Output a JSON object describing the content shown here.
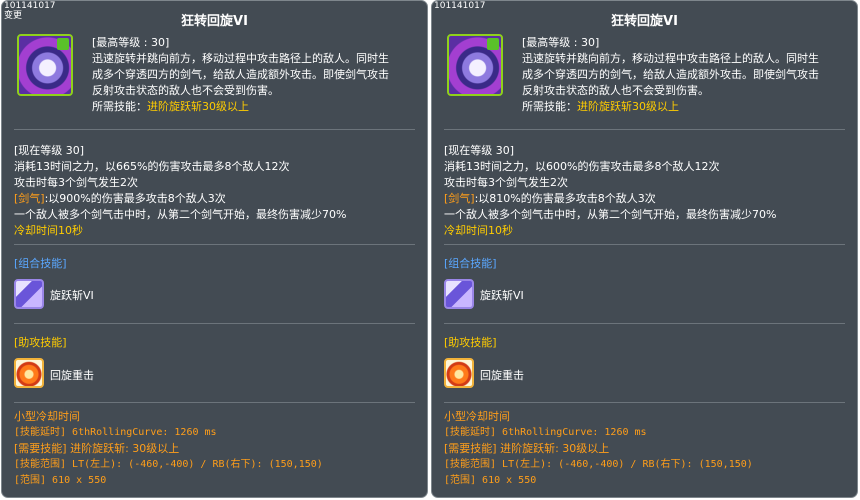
{
  "panels": [
    {
      "skill_id": "101141017",
      "top_tag": "变更",
      "title": "狂转回旋VI",
      "desc": {
        "max_level": "[最高等级 : 30]",
        "lines": [
          "迅速旋转并跳向前方，移动过程中攻击路径上的敌人。同时生",
          "成多个穿透四方的剑气，给敌人造成额外攻击。即使剑气攻击",
          "反射攻击状态的敌人也不会受到伤害。"
        ],
        "req_label": "所需技能：",
        "req_value": "进阶旋跃斩30级以上"
      },
      "current": {
        "header": "[现在等级 30]",
        "line1": "消耗13时间之力，以665%的伤害攻击最多8个敌人12次",
        "line2": "攻击时每3个剑气发生2次",
        "sword_label": "[剑气]",
        "sword_text": ":以900%的伤害最多攻击8个敌人3次",
        "line4": "一个敌人被多个剑气击中时，从第二个剑气开始，最终伤害减少70%",
        "cooldown": "冷却时间10秒"
      },
      "combo": {
        "header": "[组合技能]",
        "skill": "旋跃斩VI",
        "icon": "whirl-slash-icon"
      },
      "assist": {
        "header": "[助攻技能]",
        "skill": "回旋重击",
        "icon": "spin-strike-icon"
      },
      "footer": [
        "小型冷却时间",
        "[技能延时] 6thRollingCurve: 1260 ms",
        "[需要技能] 进阶旋跃斩: 30级以上",
        "[技能范围] LT(左上): (-460,-400) / RB(右下): (150,150)",
        "[范围] 610 x 550"
      ]
    },
    {
      "skill_id": "101141017",
      "top_tag": "",
      "title": "狂转回旋VI",
      "desc": {
        "max_level": "[最高等级 : 30]",
        "lines": [
          "迅速旋转并跳向前方，移动过程中攻击路径上的敌人。同时生",
          "成多个穿透四方的剑气，给敌人造成额外攻击。即使剑气攻击",
          "反射攻击状态的敌人也不会受到伤害。"
        ],
        "req_label": "所需技能：",
        "req_value": "进阶旋跃斩30级以上"
      },
      "current": {
        "header": "[现在等级 30]",
        "line1": "消耗13时间之力，以600%的伤害攻击最多8个敌人12次",
        "line2": "攻击时每3个剑气发生2次",
        "sword_label": "[剑气]",
        "sword_text": ":以810%的伤害最多攻击8个敌人3次",
        "line4": "一个敌人被多个剑气击中时，从第二个剑气开始，最终伤害减少70%",
        "cooldown": "冷却时间10秒"
      },
      "combo": {
        "header": "[组合技能]",
        "skill": "旋跃斩VI",
        "icon": "whirl-slash-icon"
      },
      "assist": {
        "header": "[助攻技能]",
        "skill": "回旋重击",
        "icon": "spin-strike-icon"
      },
      "footer": [
        "小型冷却时间",
        "[技能延时] 6thRollingCurve: 1260 ms",
        "[需要技能] 进阶旋跃斩: 30级以上",
        "[技能范围] LT(左上): (-460,-400) / RB(右下): (150,150)",
        "[范围] 610 x 550"
      ]
    }
  ],
  "colors": {
    "panel_bg": "#434b53",
    "accent_orange": "#ff9e1a",
    "accent_gold": "#ffcc00",
    "accent_blue": "#5aa7ff"
  }
}
